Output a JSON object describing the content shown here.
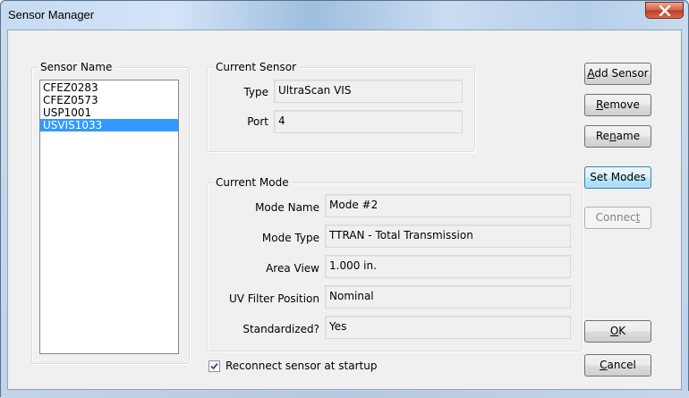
{
  "window": {
    "title": "Sensor Manager"
  },
  "sensor_list": {
    "group_label": "Sensor Name",
    "items": [
      "CFEZ0283",
      "CFEZ0573",
      "USP1001",
      "USVIS1033"
    ],
    "selected_index": 3
  },
  "current_sensor": {
    "group_label": "Current Sensor",
    "type_label": "Type",
    "type_value": "UltraScan VIS",
    "port_label": "Port",
    "port_value": "4"
  },
  "current_mode": {
    "group_label": "Current Mode",
    "fields": [
      {
        "label": "Mode Name",
        "value": "Mode #2"
      },
      {
        "label": "Mode Type",
        "value": "TTRAN - Total Transmission"
      },
      {
        "label": "Area View",
        "value": "1.000 in."
      },
      {
        "label": "UV Filter Position",
        "value": "Nominal"
      },
      {
        "label": "Standardized?",
        "value": "Yes"
      }
    ]
  },
  "buttons": {
    "add_sensor": {
      "mnemonic": "A",
      "rest": "dd Sensor"
    },
    "remove": {
      "mnemonic": "R",
      "rest": "emove"
    },
    "rename": {
      "pre": "Re",
      "mnemonic": "n",
      "rest": "ame"
    },
    "set_modes": {
      "label": "Set Modes"
    },
    "connect": {
      "pre": "Connec",
      "mnemonic": "t"
    },
    "ok": {
      "mnemonic": "O",
      "rest": "K"
    },
    "cancel": {
      "mnemonic": "C",
      "rest": "ancel"
    }
  },
  "reconnect_checkbox": {
    "label": "Reconnect sensor at startup",
    "checked": true
  },
  "colors": {
    "selection": "#3399ff",
    "close_button": "#c23a22"
  },
  "icons": {
    "close": "close-icon",
    "check": "checkmark-icon"
  }
}
